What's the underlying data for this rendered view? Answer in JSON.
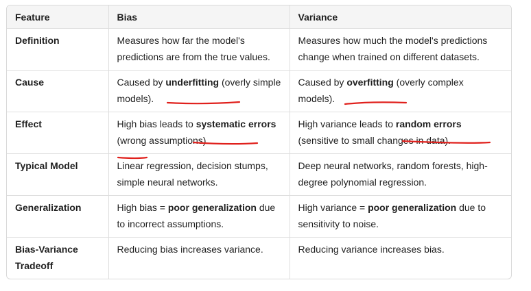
{
  "table": {
    "headers": [
      "Feature",
      "Bias",
      "Variance"
    ],
    "rows": [
      {
        "feature": "Definition",
        "bias": [
          {
            "t": "Measures how far the model's predictions are from the true values.",
            "b": false
          }
        ],
        "variance": [
          {
            "t": "Measures how much the model's predictions change when trained on different datasets.",
            "b": false
          }
        ]
      },
      {
        "feature": "Cause",
        "bias": [
          {
            "t": "Caused by ",
            "b": false
          },
          {
            "t": "underfitting",
            "b": true
          },
          {
            "t": " (overly simple models).",
            "b": false
          }
        ],
        "variance": [
          {
            "t": "Caused by ",
            "b": false
          },
          {
            "t": "overfitting",
            "b": true
          },
          {
            "t": " (overly complex models).",
            "b": false
          }
        ]
      },
      {
        "feature": "Effect",
        "bias": [
          {
            "t": "High bias leads to ",
            "b": false
          },
          {
            "t": "systematic errors",
            "b": true
          },
          {
            "t": " (wrong assumptions).",
            "b": false
          }
        ],
        "variance": [
          {
            "t": "High variance leads to ",
            "b": false
          },
          {
            "t": "random errors",
            "b": true
          },
          {
            "t": " (sensitive to small changes in data).",
            "b": false
          }
        ]
      },
      {
        "feature": "Typical Model",
        "bias": [
          {
            "t": "Linear regression, decision stumps, simple neural networks.",
            "b": false
          }
        ],
        "variance": [
          {
            "t": "Deep neural networks, random forests, high-degree polynomial regression.",
            "b": false
          }
        ]
      },
      {
        "feature": "Generalization",
        "bias": [
          {
            "t": "High bias = ",
            "b": false
          },
          {
            "t": "poor generalization",
            "b": true
          },
          {
            "t": " due to incorrect assumptions.",
            "b": false
          }
        ],
        "variance": [
          {
            "t": "High variance = ",
            "b": false
          },
          {
            "t": "poor generalization",
            "b": true
          },
          {
            "t": " due to sensitivity to noise.",
            "b": false
          }
        ]
      },
      {
        "feature": "Bias-Variance Tradeoff",
        "bias": [
          {
            "t": "Reducing bias increases variance.",
            "b": false
          }
        ],
        "variance": [
          {
            "t": "Reducing variance increases bias.",
            "b": false
          }
        ]
      }
    ]
  },
  "annotation_color": "#e0201c"
}
